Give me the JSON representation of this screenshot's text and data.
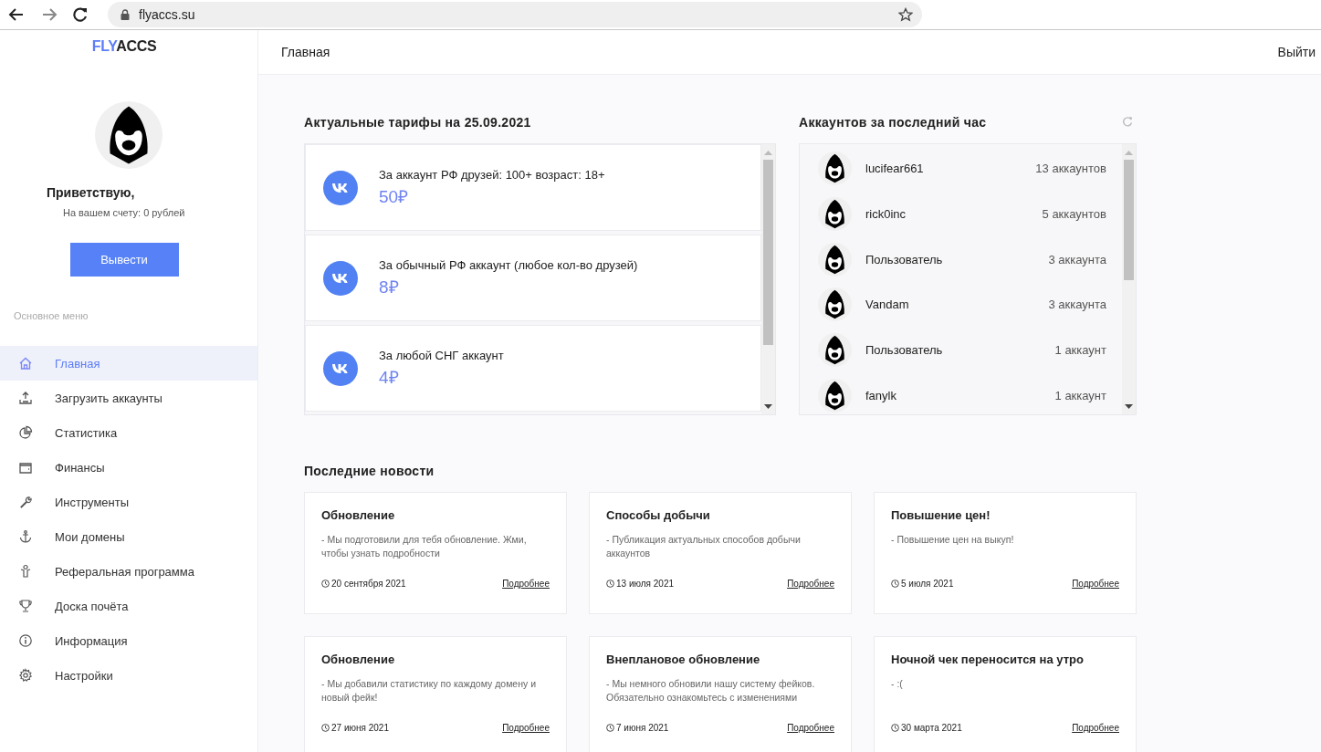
{
  "browser": {
    "url": "flyaccs.su"
  },
  "logo": {
    "accent": "FLY",
    "rest": "ACCS"
  },
  "profile": {
    "greeting": "Приветствую,",
    "balance": "На вашем счету: 0 рублей",
    "withdraw_button": "Вывести"
  },
  "menu": {
    "title": "Основное меню",
    "items": [
      {
        "label": "Главная",
        "selected": true
      },
      {
        "label": "Загрузить аккаунты",
        "selected": false
      },
      {
        "label": "Статистика",
        "selected": false
      },
      {
        "label": "Финансы",
        "selected": false
      },
      {
        "label": "Инструменты",
        "selected": false
      },
      {
        "label": "Мои домены",
        "selected": false
      },
      {
        "label": "Реферальная программа",
        "selected": false
      },
      {
        "label": "Доска почёта",
        "selected": false
      },
      {
        "label": "Информация",
        "selected": false
      },
      {
        "label": "Настройки",
        "selected": false
      }
    ]
  },
  "header": {
    "title": "Главная",
    "logout": "Выйти"
  },
  "tariffs": {
    "title": "Актуальные тарифы на 25.09.2021",
    "items": [
      {
        "name": "За аккаунт РФ друзей: 100+ возраст: 18+",
        "price": "50₽"
      },
      {
        "name": "За обычный РФ аккаунт (любое кол-во друзей)",
        "price": "8₽"
      },
      {
        "name": "За любой СНГ аккаунт",
        "price": "4₽"
      }
    ]
  },
  "accounts": {
    "title": "Аккаунтов за последний час",
    "items": [
      {
        "name": "lucifear661",
        "count": "13 аккаунтов"
      },
      {
        "name": "rick0inc",
        "count": "5 аккаунтов"
      },
      {
        "name": "Пользователь",
        "count": "3 аккаунта"
      },
      {
        "name": "Vandam",
        "count": "3 аккаунта"
      },
      {
        "name": "Пользователь",
        "count": "1 аккаунт"
      },
      {
        "name": "fanylk",
        "count": "1 аккаунт"
      }
    ]
  },
  "news": {
    "title": "Последние новости",
    "items": [
      {
        "title": "Обновление",
        "text": "- Мы подготовили для тебя обновление. Жми, чтобы узнать подробности",
        "date": "20 сентября 2021",
        "link": "Подробнее"
      },
      {
        "title": "Способы добычи",
        "text": "- Публикация актуальных способов добычи аккаунтов",
        "date": "13 июля 2021",
        "link": "Подробнее"
      },
      {
        "title": "Повышение цен!",
        "text": "- Повышение цен на выкуп!",
        "date": "5 июля 2021",
        "link": "Подробнее"
      },
      {
        "title": "Обновление",
        "text": "- Мы добавили статистику по каждому домену и новый фейк!",
        "date": "27 июня 2021",
        "link": "Подробнее"
      },
      {
        "title": "Внеплановое обновление",
        "text": "- Мы немного обновили нашу систему фейков. Обязательно ознакомьтесь с изменениями",
        "date": "7 июня 2021",
        "link": "Подробнее"
      },
      {
        "title": "Ночной чек переносится на утро",
        "text": "- :(",
        "date": "30 марта 2021",
        "link": "Подробнее"
      }
    ]
  }
}
